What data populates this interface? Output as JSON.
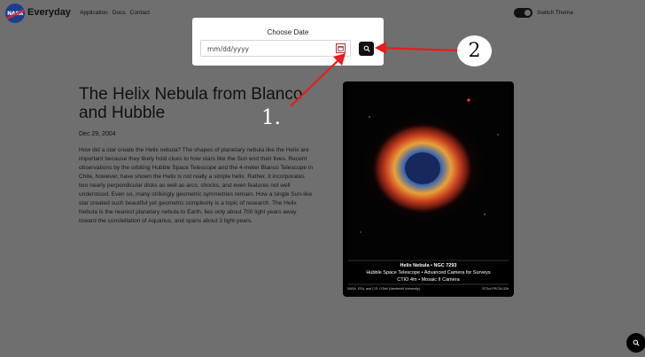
{
  "header": {
    "logo_text": "NASA",
    "brand": "Everyday",
    "nav": [
      "Application",
      "Docs",
      "Contact"
    ],
    "theme_toggle_label": "Switch Theme"
  },
  "date_picker": {
    "title": "Choose Date",
    "placeholder": "mm/dd/yyyy",
    "calendar_icon": "calendar-icon",
    "search_icon": "search-icon"
  },
  "article": {
    "title": "The Helix Nebula from Blanco and Hubble",
    "date": "Dec 29, 2004",
    "description": "How did a star create the Helix nebula? The shapes of planetary nebula like the Helix are important because they likely hold clues to how stars like the Sun end their lives. Recent observations by the orbiting Hubble Space Telescope and the 4-meter Blanco Telescope in Chile, however, have shown the Helix is not really a simple helix. Rather, it incorporates two nearly perpendicular disks as well as arcs, shocks, and even features not well understood. Even so, many strikingly geometric symmetries remain. How a single Sun-like star created such beautiful yet geometric complexity is a topic of research. The Helix Nebula is the nearest planetary nebula to Earth, lies only about 700 light years away toward the constellation of Aquarius, and spans about 3 light-years."
  },
  "image": {
    "caption_line1": "Helix Nebula • NGC 7293",
    "caption_line2": "Hubble Space Telescope • Advanced Camera for Surveys",
    "caption_line3": "CTIO 4m • Mosaic II Camera",
    "credit_left": "NASA, ESA, and C.R. O'Dell (Vanderbilt University)",
    "credit_right": "STScI-PRC04-32b"
  },
  "annotations": {
    "marker_1": "1.",
    "marker_2": "2",
    "color": "#e81d1d"
  },
  "floating_button_icon": "search-icon"
}
